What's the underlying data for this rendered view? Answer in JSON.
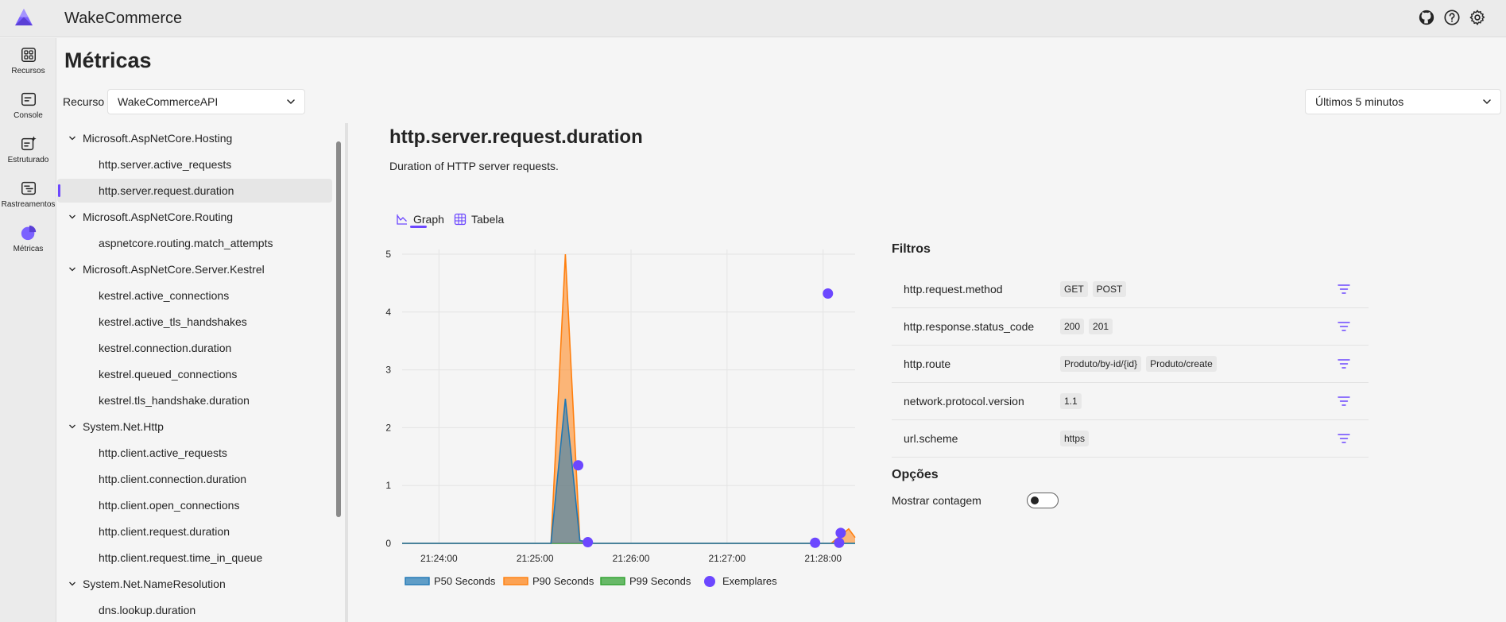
{
  "app": {
    "title": "WakeCommerce"
  },
  "nav": {
    "items": [
      {
        "label": "Recursos"
      },
      {
        "label": "Console"
      },
      {
        "label": "Estruturado"
      },
      {
        "label": "Rastreamentos"
      },
      {
        "label": "Métricas"
      }
    ]
  },
  "page": {
    "title": "Métricas"
  },
  "recurso": {
    "label": "Recurso",
    "value": "WakeCommerceAPI"
  },
  "time_range": {
    "value": "Últimos 5 minutos"
  },
  "tree": {
    "rows": [
      {
        "kind": "group",
        "label": "Microsoft.AspNetCore.Hosting"
      },
      {
        "kind": "leaf",
        "label": "http.server.active_requests"
      },
      {
        "kind": "leaf",
        "label": "http.server.request.duration",
        "selected": true
      },
      {
        "kind": "group",
        "label": "Microsoft.AspNetCore.Routing"
      },
      {
        "kind": "leaf",
        "label": "aspnetcore.routing.match_attempts"
      },
      {
        "kind": "group",
        "label": "Microsoft.AspNetCore.Server.Kestrel"
      },
      {
        "kind": "leaf",
        "label": "kestrel.active_connections"
      },
      {
        "kind": "leaf",
        "label": "kestrel.active_tls_handshakes"
      },
      {
        "kind": "leaf",
        "label": "kestrel.connection.duration"
      },
      {
        "kind": "leaf",
        "label": "kestrel.queued_connections"
      },
      {
        "kind": "leaf",
        "label": "kestrel.tls_handshake.duration"
      },
      {
        "kind": "group",
        "label": "System.Net.Http"
      },
      {
        "kind": "leaf",
        "label": "http.client.active_requests"
      },
      {
        "kind": "leaf",
        "label": "http.client.connection.duration"
      },
      {
        "kind": "leaf",
        "label": "http.client.open_connections"
      },
      {
        "kind": "leaf",
        "label": "http.client.request.duration"
      },
      {
        "kind": "leaf",
        "label": "http.client.request.time_in_queue"
      },
      {
        "kind": "group",
        "label": "System.Net.NameResolution"
      },
      {
        "kind": "leaf",
        "label": "dns.lookup.duration"
      }
    ]
  },
  "metric": {
    "title": "http.server.request.duration",
    "description": "Duration of HTTP server requests."
  },
  "tabs": [
    {
      "label": "Graph"
    },
    {
      "label": "Tabela"
    }
  ],
  "chart_data": {
    "type": "area",
    "title": "",
    "xlabel": "",
    "ylabel": "",
    "ylim": [
      0,
      5
    ],
    "y_ticks": [
      "0",
      "1",
      "2",
      "3",
      "4",
      "5"
    ],
    "x_ticks": [
      "21:24:00",
      "21:25:00",
      "21:26:00",
      "21:27:00",
      "21:28:00"
    ],
    "grid": true,
    "legend_position": "bottom",
    "series": [
      {
        "name": "P50 Seconds",
        "color": "#1f77b4",
        "points": [
          [
            "21:23:37",
            0
          ],
          [
            "21:25:10",
            0
          ],
          [
            "21:25:19",
            2.5
          ],
          [
            "21:25:28",
            0.05
          ],
          [
            "21:25:37",
            0
          ],
          [
            "21:28:20",
            0
          ]
        ]
      },
      {
        "name": "P90 Seconds",
        "color": "#ff7f0e",
        "points": [
          [
            "21:23:37",
            0
          ],
          [
            "21:25:10",
            0
          ],
          [
            "21:25:19",
            5
          ],
          [
            "21:25:28",
            0.05
          ],
          [
            "21:25:37",
            0
          ],
          [
            "21:28:05",
            0
          ],
          [
            "21:28:16",
            0.25
          ],
          [
            "21:28:20",
            0.1
          ]
        ]
      },
      {
        "name": "P99 Seconds",
        "color": "#2ca02c",
        "points": [
          [
            "21:23:37",
            0
          ],
          [
            "21:28:20",
            0
          ]
        ]
      }
    ],
    "exemplars": {
      "name": "Exemplares",
      "color": "#6c47ff",
      "points": [
        [
          "21:25:27",
          1.35
        ],
        [
          "21:25:33",
          0.02
        ],
        [
          "21:28:03",
          4.32
        ],
        [
          "21:27:55",
          0.01
        ],
        [
          "21:28:11",
          0.18
        ],
        [
          "21:28:10",
          0.01
        ]
      ]
    }
  },
  "filters": {
    "title": "Filtros",
    "rows": [
      {
        "name": "http.request.method",
        "values": [
          "GET",
          "POST"
        ]
      },
      {
        "name": "http.response.status_code",
        "values": [
          "200",
          "201"
        ]
      },
      {
        "name": "http.route",
        "values": [
          "Produto/by-id/{id}",
          "Produto/create"
        ]
      },
      {
        "name": "network.protocol.version",
        "values": [
          "1.1"
        ]
      },
      {
        "name": "url.scheme",
        "values": [
          "https"
        ]
      }
    ]
  },
  "options": {
    "title": "Opções",
    "show_count_label": "Mostrar contagem",
    "show_count": false
  }
}
